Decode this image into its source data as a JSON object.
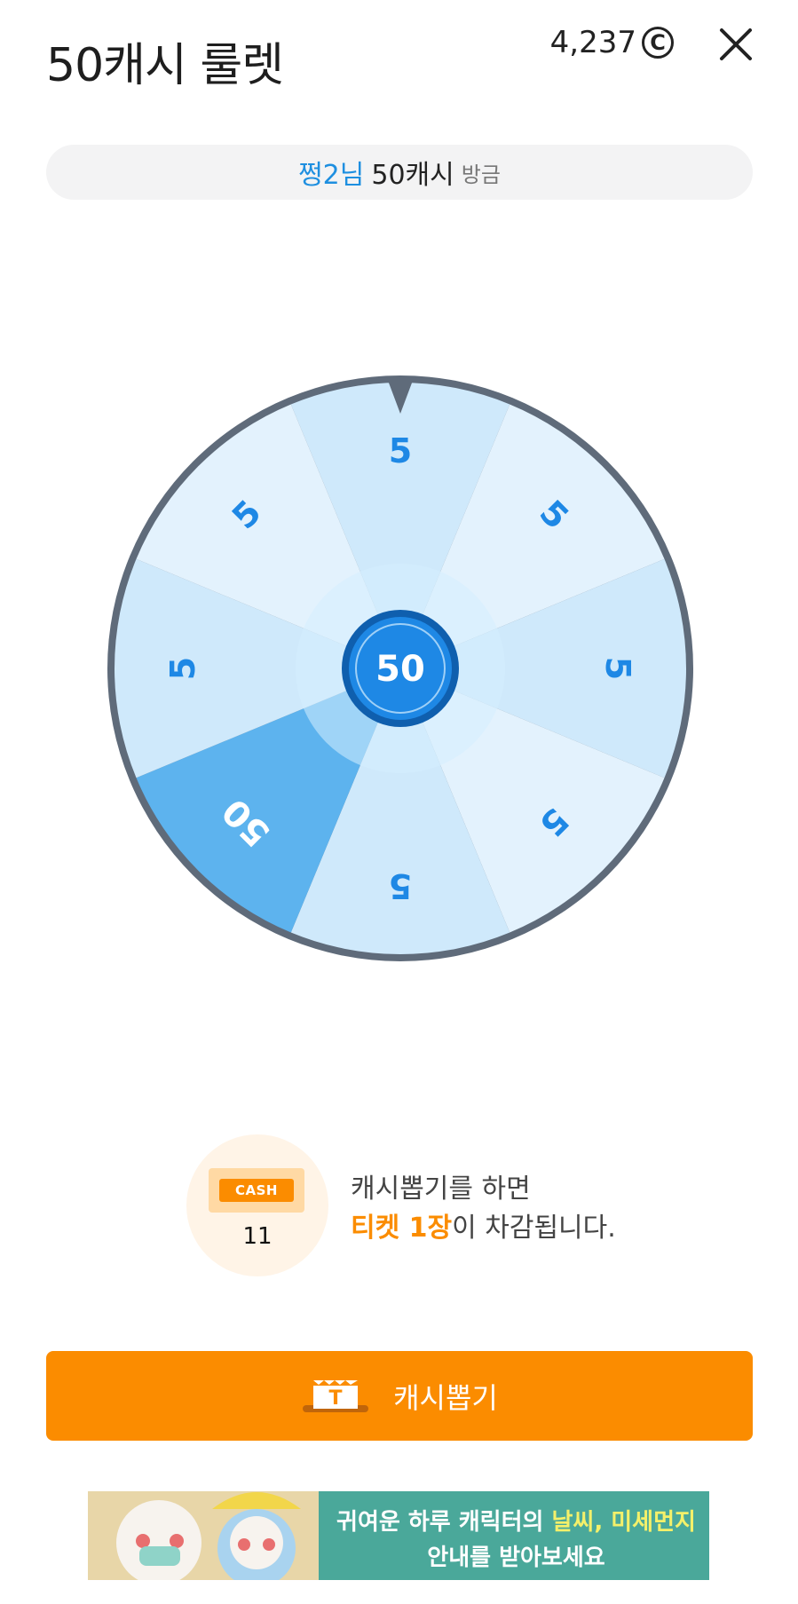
{
  "header": {
    "title": "50캐시 룰렛",
    "balance": "4,237",
    "coin_symbol": "C",
    "close_icon": "close-icon"
  },
  "winner": {
    "name": "쩡2님",
    "amount": "50캐시",
    "time": "방금"
  },
  "wheel": {
    "segments": [
      "5",
      "5",
      "5",
      "5",
      "5",
      "50",
      "5",
      "5"
    ],
    "center": "50",
    "colors": {
      "rim": "#5f6b7a",
      "light": "#e3f2fd",
      "mid": "#cfe9fb",
      "highlight": "#5db3ee",
      "hub": "#1e88e5",
      "text": "#1e88e5"
    }
  },
  "ticket": {
    "badge": "CASH",
    "count": "11",
    "line1": "캐시뽑기를 하면",
    "accent": "티켓 1장",
    "line2_rest": "이 차감됩니다."
  },
  "draw_button": {
    "label": "캐시뽑기",
    "icon_letter": "T",
    "color": "#fb8c00"
  },
  "ad": {
    "line1_a": "귀여운 하루 캐릭터의 ",
    "line1_b": "날씨, 미세먼지",
    "line2": "안내를 받아보세요"
  }
}
